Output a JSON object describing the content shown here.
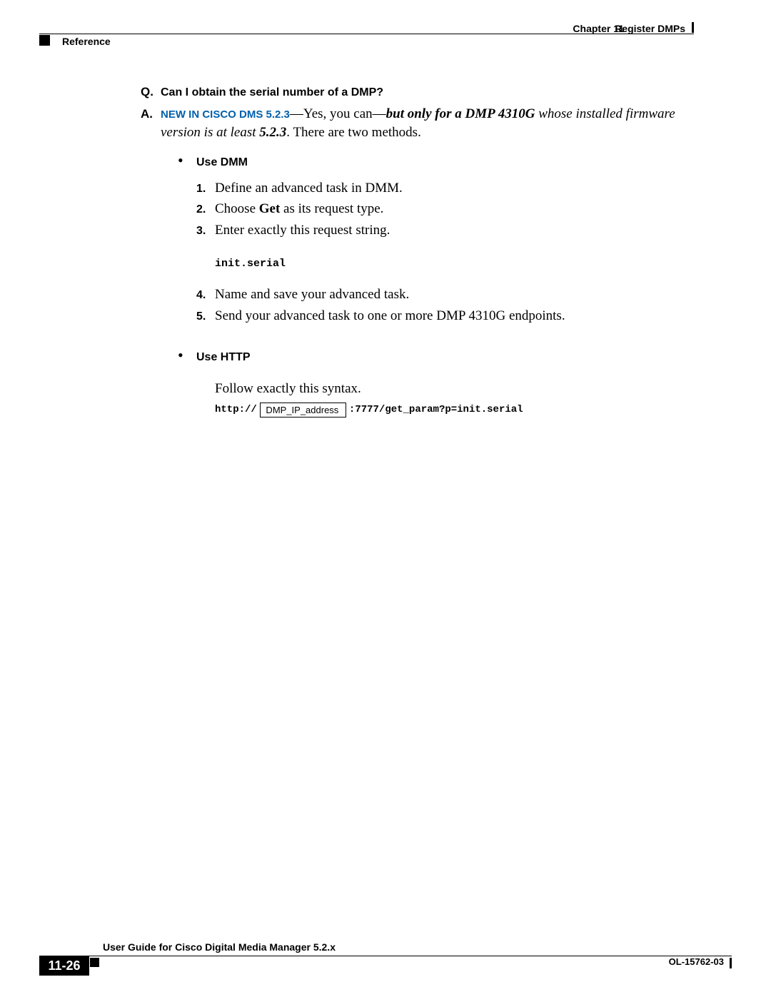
{
  "header": {
    "chapter": "Chapter 11",
    "title": "Register DMPs",
    "section": "Reference"
  },
  "q": {
    "label": "Q.",
    "text": "Can I obtain the serial number of a DMP?"
  },
  "a": {
    "label": "A.",
    "new_in": "NEW IN CISCO DMS 5.2.3",
    "dash": "—",
    "yes": "Yes, you can",
    "but_only": "but only for a DMP 4310G",
    "whose": " whose installed firmware version is at least ",
    "ver": "5.2.3",
    "tail": ". There are two methods."
  },
  "use_dmm": {
    "heading": "Use DMM",
    "steps": [
      {
        "n": "1.",
        "pre": "Define an advanced task in DMM."
      },
      {
        "n": "2.",
        "pre": "Choose ",
        "bold": "Get",
        "post": " as its request type."
      },
      {
        "n": "3.",
        "pre": "Enter exactly this request string."
      },
      {
        "n": "4.",
        "pre": "Name and save your advanced task."
      },
      {
        "n": "5.",
        "pre": "Send your advanced task to one or more DMP 4310G endpoints."
      }
    ],
    "code": "init.serial"
  },
  "use_http": {
    "heading": "Use HTTP",
    "follow": "Follow exactly this syntax.",
    "prefix": "http://",
    "box": " DMP_IP_address ",
    "suffix": ":7777/get_param?p=init.serial"
  },
  "footer": {
    "guide": "User Guide for Cisco Digital Media Manager 5.2.x",
    "page": "11-26",
    "doc": "OL-15762-03"
  }
}
